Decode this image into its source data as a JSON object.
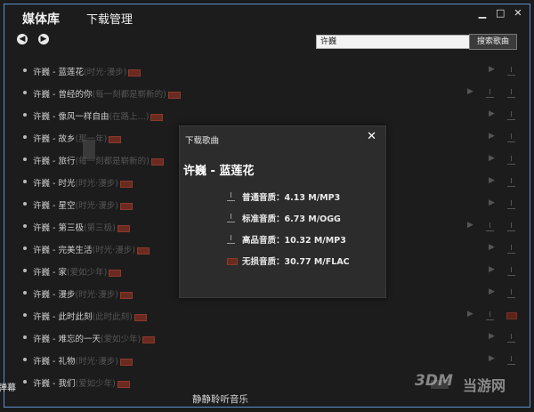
{
  "app": {
    "brand": "媒体库",
    "title": "下载管理"
  },
  "window": {
    "min": "▁",
    "max": "□",
    "close": "✕"
  },
  "nav": {
    "back": "◀",
    "forward": "▶"
  },
  "search": {
    "value": "许巍",
    "button": "搜索歌曲"
  },
  "songs": [
    {
      "artist_title": "许巍 - 蓝莲花",
      "album": "(时光·漫步)"
    },
    {
      "artist_title": "许巍 - 曾经的你",
      "album": "(每一刻都是崭新的)"
    },
    {
      "artist_title": "许巍 - 像风一样自由",
      "album": "(在路上...)"
    },
    {
      "artist_title": "许巍 - 故乡",
      "album": "(那一年)"
    },
    {
      "artist_title": "许巍 - 旅行",
      "album": "(每一刻都是崭新的)"
    },
    {
      "artist_title": "许巍 - 时光",
      "album": "(时光·漫步)"
    },
    {
      "artist_title": "许巍 - 星空",
      "album": "(时光·漫步)"
    },
    {
      "artist_title": "许巍 - 第三极",
      "album": "(第三极)"
    },
    {
      "artist_title": "许巍 - 完美生活",
      "album": "(时光·漫步)"
    },
    {
      "artist_title": "许巍 - 家",
      "album": "(爱如少年)"
    },
    {
      "artist_title": "许巍 - 漫步",
      "album": "(时光·漫步)"
    },
    {
      "artist_title": "许巍 - 此时此刻",
      "album": "(此时此刻)"
    },
    {
      "artist_title": "许巍 - 难忘的一天",
      "album": "(爱如少年)"
    },
    {
      "artist_title": "许巍 - 礼物",
      "album": "(时光·漫步)"
    },
    {
      "artist_title": "许巍 - 我们",
      "album": "(爱如少年)"
    }
  ],
  "dialog": {
    "title": "下载歌曲",
    "close": "✕",
    "song": "许巍 - 蓝莲花",
    "options": [
      {
        "label": "普通音质：4.13 M/MP3",
        "icon": "download-icon"
      },
      {
        "label": "标准音质：6.73 M/OGG",
        "icon": "download-icon"
      },
      {
        "label": "高品音质：10.32 M/MP3",
        "icon": "download-icon"
      },
      {
        "label": "无损音质：30.77 M/FLAC",
        "icon": "lossless-icon"
      }
    ]
  },
  "footer": {
    "danmaku": "弹幕",
    "tagline": "静静聆听音乐"
  },
  "watermark": {
    "mark": "3DM",
    "site": "当游网"
  },
  "colors": {
    "accent_red": "#6b2a20",
    "frame_border": "#5b8fcf",
    "background": "#1c1c1c",
    "dialog_bg": "#2c2c2c"
  }
}
